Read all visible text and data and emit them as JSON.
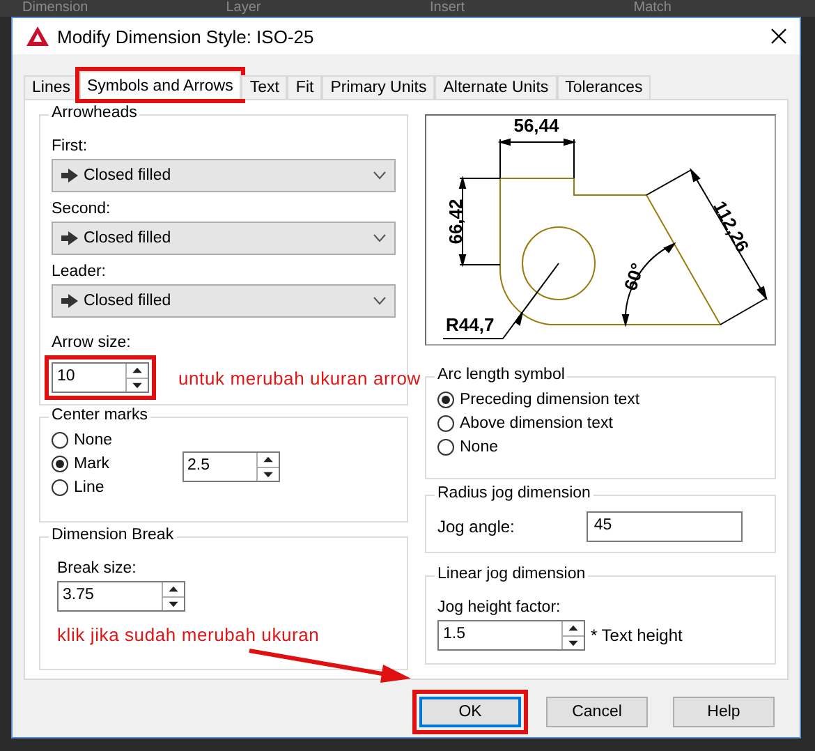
{
  "background": {
    "ribbon": [
      "Dimension",
      "Layer",
      "Insert",
      "Match"
    ]
  },
  "window": {
    "title": "Modify Dimension Style: ISO-25"
  },
  "tabs": [
    {
      "label": "Lines",
      "selected": false,
      "highlighted": false
    },
    {
      "label": "Symbols and Arrows",
      "selected": true,
      "highlighted": true
    },
    {
      "label": "Text",
      "selected": false,
      "highlighted": false
    },
    {
      "label": "Fit",
      "selected": false,
      "highlighted": false
    },
    {
      "label": "Primary Units",
      "selected": false,
      "highlighted": false
    },
    {
      "label": "Alternate Units",
      "selected": false,
      "highlighted": false
    },
    {
      "label": "Tolerances",
      "selected": false,
      "highlighted": false
    }
  ],
  "arrowheads": {
    "title": "Arrowheads",
    "fields": [
      {
        "label": "First:",
        "value": "Closed filled"
      },
      {
        "label": "Second:",
        "value": "Closed filled"
      },
      {
        "label": "Leader:",
        "value": "Closed filled"
      }
    ],
    "arrow_size": {
      "label": "Arrow size:",
      "value": "10",
      "highlighted": true,
      "note": "untuk merubah ukuran arrow"
    }
  },
  "center_marks": {
    "title": "Center marks",
    "options": [
      {
        "label": "None",
        "selected": false
      },
      {
        "label": "Mark",
        "selected": true
      },
      {
        "label": "Line",
        "selected": false
      }
    ],
    "size": "2.5"
  },
  "dimension_break": {
    "title": "Dimension Break",
    "label": "Break size:",
    "value": "3.75",
    "note": "klik jika sudah merubah ukuran"
  },
  "preview": {
    "labels": [
      {
        "kind": "top",
        "text": "56,44"
      },
      {
        "kind": "left",
        "text": "66,42"
      },
      {
        "kind": "slant",
        "text": "112,26"
      },
      {
        "kind": "angle",
        "text": "60°"
      },
      {
        "kind": "radius",
        "text": "R44,7"
      }
    ]
  },
  "arc_length_symbol": {
    "title": "Arc length symbol",
    "options": [
      {
        "label": "Preceding dimension text",
        "selected": true
      },
      {
        "label": "Above dimension text",
        "selected": false
      },
      {
        "label": "None",
        "selected": false
      }
    ]
  },
  "radius_jog": {
    "title": "Radius jog dimension",
    "label": "Jog angle:",
    "value": "45"
  },
  "linear_jog": {
    "title": "Linear jog dimension",
    "label": "Jog height factor:",
    "value": "1.5",
    "suffix": "* Text height"
  },
  "buttons": [
    {
      "label": "OK",
      "default": true,
      "highlighted": true
    },
    {
      "label": "Cancel",
      "default": false,
      "highlighted": false
    },
    {
      "label": "Help",
      "default": false,
      "highlighted": false
    }
  ]
}
